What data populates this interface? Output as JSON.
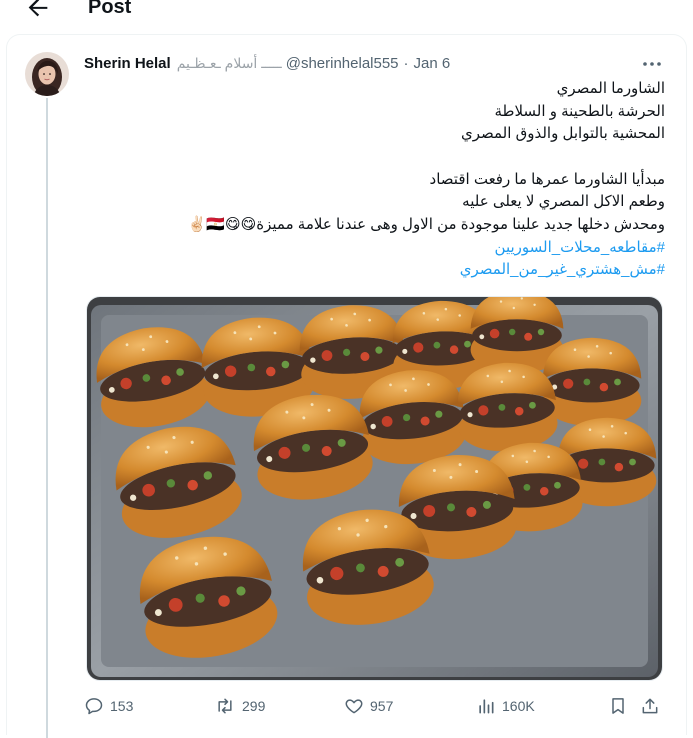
{
  "header": {
    "title": "Post"
  },
  "tweet": {
    "author_name": "Sherin Helal",
    "name_decoration": "ـــــ أسلام ـعـظـيم",
    "handle": "@sherinhelal555",
    "separator": "·",
    "date": "Jan 6",
    "lines": [
      "الشاورما المصري",
      "الحرشة بالطحينة و السلاطة",
      "المحشية بالتوابل والذوق المصري",
      "مبدأيا الشاورما عمرها ما رفعت اقتصاد",
      "وطعم الاكل المصري لا يعلى عليه",
      "ومحدش دخلها جديد علينا موجودة من الاول وهى عندنا علامة مميزة😋😋🇪🇬✌🏻"
    ],
    "hashtags": [
      "#مقاطعه_محلات_السوريين",
      "#مش_هشتري_غير_من_المصري"
    ],
    "image_alt": "Tray of Egyptian shawarma sandwiches"
  },
  "actions": {
    "replies": "153",
    "reposts": "299",
    "likes": "957",
    "views": "160K"
  },
  "colors": {
    "text": "#0f1419",
    "secondary": "#536471",
    "link": "#1d9bf0",
    "border": "#eff3f4"
  },
  "icons": [
    "back-arrow-icon",
    "more-icon",
    "reply-icon",
    "repost-icon",
    "like-icon",
    "views-icon",
    "bookmark-icon",
    "share-icon"
  ]
}
